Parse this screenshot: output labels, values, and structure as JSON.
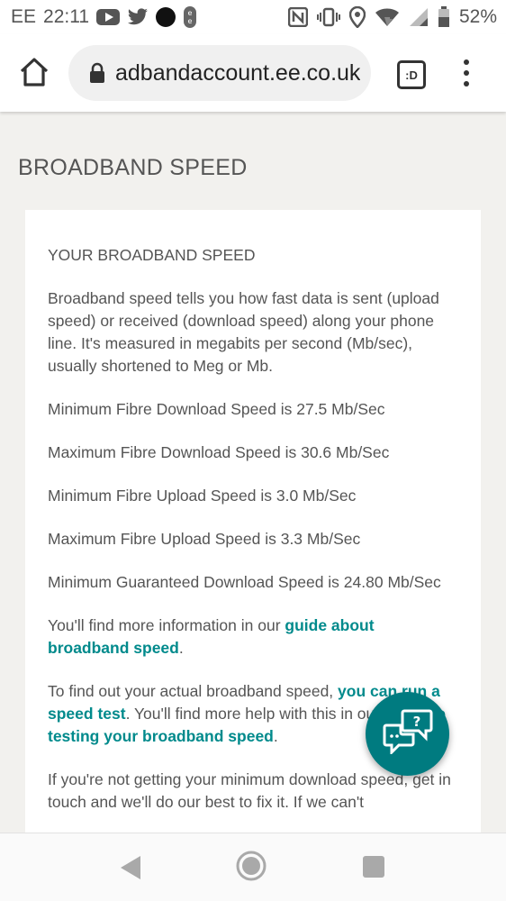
{
  "status_bar": {
    "carrier": "EE",
    "time": "22:11",
    "battery": "52%",
    "icons": [
      "youtube-icon",
      "twitter-icon",
      "dot-icon",
      "ee-icon",
      "nfc-icon",
      "vibrate-icon",
      "location-icon",
      "wifi-icon",
      "signal-icon",
      "battery-icon"
    ]
  },
  "browser": {
    "url": "adbandaccount.ee.co.uk",
    "tab_label": ":D"
  },
  "page": {
    "title": "BROADBAND SPEED",
    "heading": "YOUR BROADBAND SPEED",
    "intro": "Broadband speed tells you how fast data is sent (upload speed) or received (download speed) along your phone line. It's measured in megabits per second (Mb/sec), usually shortened to Meg or Mb.",
    "speeds": [
      "Minimum Fibre Download Speed is 27.5 Mb/Sec",
      "Maximum Fibre Download Speed is 30.6 Mb/Sec",
      "Minimum Fibre Upload Speed is 3.0 Mb/Sec",
      "Maximum Fibre Upload Speed is 3.3 Mb/Sec",
      "Minimum Guaranteed Download Speed is 24.80 Mb/Sec"
    ],
    "more_info": {
      "text_before": "You'll find more information in our ",
      "link": "guide about broadband speed",
      "text_after": "."
    },
    "speed_test": {
      "text_before": "To find out your actual broadband speed, ",
      "link1": "you can run a speed test",
      "text_middle": ". You'll find more help with this in our ",
      "link2": "guide to testing your broadband speed",
      "text_after": "."
    },
    "not_getting": "If you're not getting your minimum download speed, get in touch and we'll do our best to fix it. If we can't"
  },
  "colors": {
    "accent": "#008a8c",
    "fab": "#007b80",
    "background": "#f2f1ee"
  }
}
